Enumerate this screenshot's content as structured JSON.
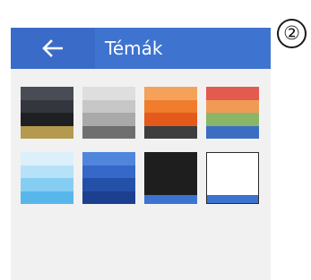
{
  "step_number": "②",
  "header": {
    "title": "Témák",
    "back_icon": "arrow-left-icon"
  },
  "colors": {
    "header_bg": "#3f73d0",
    "back_button_bg": "#3a6bc8",
    "screen_bg": "#f1f1f1"
  },
  "themes": [
    {
      "name": "dark-slate",
      "stripes": [
        "#4a4c55",
        "#34363d",
        "#1f2024",
        "#b39a4f"
      ]
    },
    {
      "name": "light-gray",
      "stripes": [
        "#dedede",
        "#c7c7c7",
        "#a9a9a9",
        "#6f6f6f"
      ]
    },
    {
      "name": "orange",
      "stripes": [
        "#f6a15a",
        "#f07c2c",
        "#e45a1c",
        "#3e3e3e"
      ]
    },
    {
      "name": "rainbow",
      "stripes": [
        "#e35a4f",
        "#f19a56",
        "#8bb567",
        "#3b6ec3"
      ]
    },
    {
      "name": "light-blue",
      "stripes": [
        "#dcf0fb",
        "#b6e1f8",
        "#86cdf2",
        "#58b7ea"
      ]
    },
    {
      "name": "blue",
      "stripes": [
        "#4f86dc",
        "#3568c8",
        "#2450a8",
        "#1c3f8f"
      ]
    },
    {
      "name": "black",
      "stripes": [
        "#1e1e1e",
        "#3c73d0"
      ]
    },
    {
      "name": "white",
      "stripes": [
        "#ffffff",
        "#3c73d0"
      ]
    }
  ]
}
